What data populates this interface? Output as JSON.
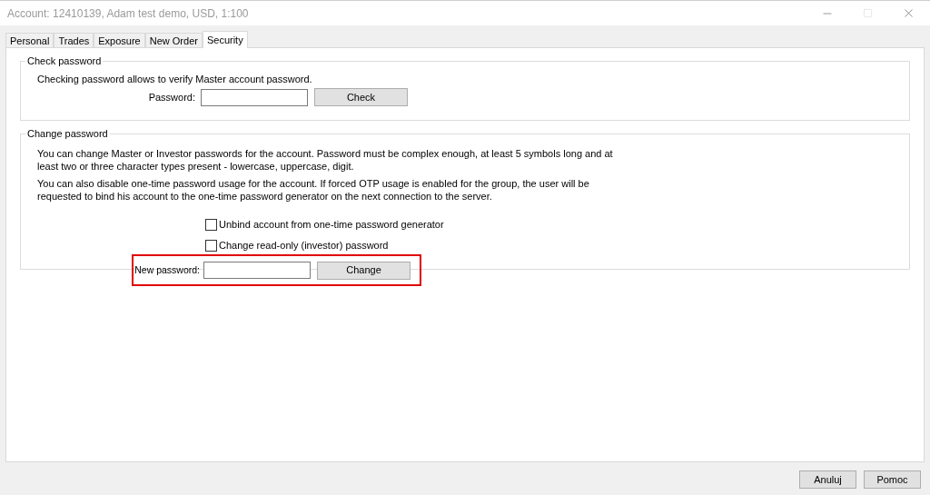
{
  "window": {
    "title": "Account: 12410139, Adam test demo, USD, 1:100"
  },
  "tabs": [
    {
      "label": "Personal",
      "selected": false
    },
    {
      "label": "Trades",
      "selected": false
    },
    {
      "label": "Exposure",
      "selected": false
    },
    {
      "label": "New Order",
      "selected": false
    },
    {
      "label": "Security",
      "selected": true
    }
  ],
  "check_password": {
    "title": "Check password",
    "description": "Checking password allows to verify Master account password.",
    "field_label": "Password:",
    "button": "Check"
  },
  "change_password": {
    "title": "Change password",
    "paragraphs": [
      "You can change Master or Investor passwords for the account. Password must be complex enough, at least 5 symbols long and at least two or three character types present - lowercase, uppercase, digit.",
      "You can also disable one-time password usage for the account. If forced OTP usage is enabled for the group, the user will be requested to bind his account to the one-time password generator on the next connection to the server."
    ],
    "options": [
      {
        "kind": "checkbox",
        "label": "Unbind account from one-time password generator",
        "checked": false
      },
      {
        "kind": "checkbox",
        "label": "Change read-only (investor) password",
        "checked": false
      }
    ],
    "field_label": "New password:",
    "button": "Change",
    "highlighted": true
  },
  "buttons": [
    "Anuluj",
    "Pomoc"
  ]
}
